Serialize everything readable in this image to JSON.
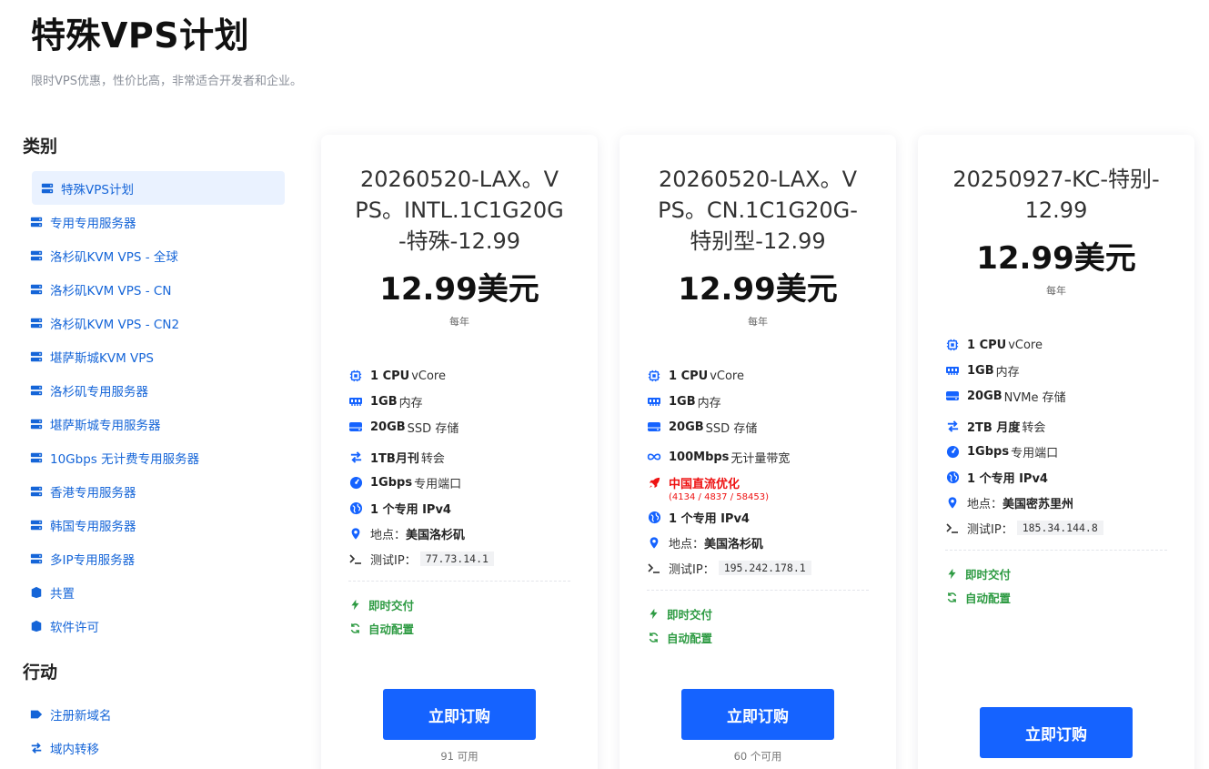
{
  "page": {
    "title": "特殊VPS计划",
    "subtitle": "限时VPS优惠，性价比高，非常适合开发者和企业。"
  },
  "sidebar": {
    "categories_heading": "类别",
    "categories": [
      {
        "label": "特殊VPS计划",
        "icon": "server-icon",
        "active": true
      },
      {
        "label": "专用专用服务器",
        "icon": "server-icon"
      },
      {
        "label": "洛杉矶KVM VPS - 全球",
        "icon": "server-icon"
      },
      {
        "label": "洛杉矶KVM VPS - CN",
        "icon": "server-icon"
      },
      {
        "label": "洛杉矶KVM VPS - CN2",
        "icon": "server-icon"
      },
      {
        "label": "堪萨斯城KVM VPS",
        "icon": "server-icon"
      },
      {
        "label": "洛杉矶专用服务器",
        "icon": "server-icon"
      },
      {
        "label": "堪萨斯城专用服务器",
        "icon": "server-icon"
      },
      {
        "label": "10Gbps 无计费专用服务器",
        "icon": "server-icon"
      },
      {
        "label": "香港专用服务器",
        "icon": "server-icon"
      },
      {
        "label": "韩国专用服务器",
        "icon": "server-icon"
      },
      {
        "label": "多IP专用服务器",
        "icon": "server-icon"
      },
      {
        "label": "共置",
        "icon": "box-icon"
      },
      {
        "label": "软件许可",
        "icon": "box-icon"
      }
    ],
    "actions_heading": "行动",
    "actions": [
      {
        "label": "注册新域名",
        "icon": "tag-icon"
      },
      {
        "label": "域内转移",
        "icon": "transfer-icon"
      }
    ]
  },
  "colors": {
    "accent": "#1563ff",
    "link": "#1565d8",
    "green": "#2e9b43",
    "red": "#e11111"
  },
  "cards": [
    {
      "title": "20260520-LAX。VPS。INTL.1C1G20G-特殊-12.99",
      "price": "12.99美元",
      "period": "每年",
      "cpu_b": "1 CPU",
      "cpu_t": " vCore",
      "ram_b": "1GB",
      "ram_t": " 内存",
      "disk_b": "20GB",
      "disk_t": " SSD 存储",
      "traffic_b": "1TB月刊",
      "traffic_t": "转会",
      "port_b": "1Gbps",
      "port_t": "专用端口",
      "ipv4_b": "1 个专用 IPv4",
      "loc_label": "地点：",
      "loc_b": "美国洛杉矶",
      "ip_label": "测试IP：",
      "ip": "77.73.14.1",
      "instant": "即时交付",
      "auto": "自动配置",
      "button": "立即订购",
      "avail": "91 可用"
    },
    {
      "title": "20260520-LAX。VPS。CN.1C1G20G-特别型-12.99",
      "price": "12.99美元",
      "period": "每年",
      "cpu_b": "1 CPU",
      "cpu_t": " vCore",
      "ram_b": "1GB",
      "ram_t": " 内存",
      "disk_b": "20GB",
      "disk_t": " SSD 存储",
      "bw_b": "100Mbps",
      "bw_t": " 无计量带宽",
      "cn_opt": "中国直流优化",
      "cn_asn": "(4134 / 4837 / 58453)",
      "ipv4_b": "1 个专用 IPv4",
      "loc_label": "地点：",
      "loc_b": "美国洛杉矶",
      "ip_label": "测试IP：",
      "ip": "195.242.178.1",
      "instant": "即时交付",
      "auto": "自动配置",
      "button": "立即订购",
      "avail": "60 个可用"
    },
    {
      "title": "20250927-KC-特别-12.99",
      "price": "12.99美元",
      "period": "每年",
      "cpu_b": "1 CPU",
      "cpu_t": " vCore",
      "ram_b": "1GB",
      "ram_t": " 内存",
      "disk_b": "20GB",
      "disk_t": " NVMe 存储",
      "traffic_b": "2TB 月度",
      "traffic_t": "转会",
      "port_b": "1Gbps",
      "port_t": "专用端口",
      "ipv4_b": "1 个专用 IPv4",
      "loc_label": "地点：",
      "loc_b": "美国密苏里州",
      "ip_label": "测试IP：",
      "ip": "185.34.144.8",
      "instant": "即时交付",
      "auto": "自动配置",
      "button": "立即订购"
    }
  ]
}
